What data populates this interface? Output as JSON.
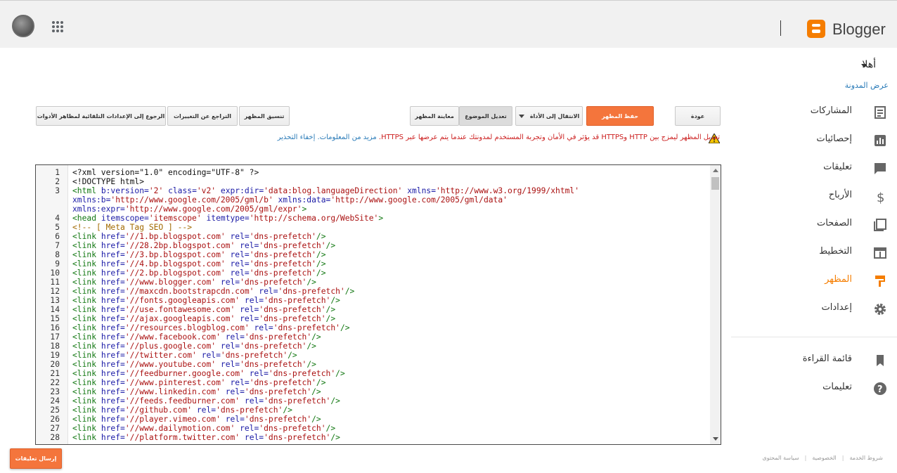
{
  "header": {
    "brand": "Blogger",
    "apps_icon": "apps-grid-icon",
    "avatar_icon": "user-avatar"
  },
  "user": {
    "greeting": "أهلا",
    "view_blog": "عرض المدونة"
  },
  "nav": {
    "items": [
      {
        "label": "المشاركات",
        "icon": "posts-icon",
        "active": false
      },
      {
        "label": "إحصائيات",
        "icon": "stats-icon",
        "active": false
      },
      {
        "label": "تعليقات",
        "icon": "comments-icon",
        "active": false
      },
      {
        "label": "الأرباح",
        "icon": "dollar-icon",
        "active": false
      },
      {
        "label": "الصفحات",
        "icon": "pages-icon",
        "active": false
      },
      {
        "label": "التخطيط",
        "icon": "layout-icon",
        "active": false
      },
      {
        "label": "المظهر",
        "icon": "theme-brush-icon",
        "active": true
      },
      {
        "label": "إعدادات",
        "icon": "gear-icon",
        "active": false
      }
    ],
    "secondary": [
      {
        "label": "قائمة القراءة",
        "icon": "bookmark-icon"
      },
      {
        "label": "تعليمات",
        "icon": "help-icon"
      }
    ]
  },
  "toolbar": {
    "back": "عودة",
    "save": "حفظ المظهر",
    "jump_to_widget": "الانتقال إلى الأداة",
    "edit_theme": "تعديل الموضوع",
    "preview": "معاينة المظهر",
    "format": "تنسيق المظهر",
    "revert": "التراجع عن التغييرات",
    "reset_widgets": "الرجوع إلى الإعدادات التلقائية لمظاهر الأدوات"
  },
  "warning": {
    "text": "تعديل المظهر ليمزج بين HTTP وHTTPS قد يؤثر في الأمان وتجربة المستخدم لمدونتك عندما يتم عرضها عبر HTTPS.",
    "learn_more": "مزيد من المعلومات.",
    "dismiss": "إخفاء التحذير"
  },
  "editor": {
    "lines": [
      {
        "n": "1",
        "html": "&lt;?xml version=\"1.0\" encoding=\"UTF-8\" ?&gt;"
      },
      {
        "n": "2",
        "html": "&lt;!DOCTYPE html&gt;"
      },
      {
        "n": "3",
        "html": "<span class='t'>&lt;html</span> <span class='a'>b:version=</span><span class='v'>'2'</span> <span class='a'>class=</span><span class='v'>'v2'</span> <span class='a'>expr:dir=</span><span class='v'>'data:blog.languageDirection'</span> <span class='a'>xmlns=</span><span class='v'>'http://www.w3.org/1999/xhtml'</span>"
      },
      {
        "n": "",
        "html": "<span class='a'>xmlns:b=</span><span class='v'>'http://www.google.com/2005/gml/b'</span> <span class='a'>xmlns:data=</span><span class='v'>'http://www.google.com/2005/gml/data'</span>"
      },
      {
        "n": "",
        "html": "<span class='a'>xmlns:expr=</span><span class='v'>'http://www.google.com/2005/gml/expr'</span><span class='t'>&gt;</span>"
      },
      {
        "n": "4",
        "html": "<span class='t'>&lt;head</span> <span class='a'>itemscope=</span><span class='v'>'itemscope'</span> <span class='a'>itemtype=</span><span class='v'>'http://schema.org/WebSite'</span><span class='t'>&gt;</span>"
      },
      {
        "n": "5",
        "html": "<span class='c'>&lt;!-- [ Meta Tag SEO ] --&gt;</span>"
      },
      {
        "n": "6",
        "html": "<span class='t'>&lt;link</span> <span class='a'>href=</span><span class='v'>'//1.bp.blogspot.com'</span> <span class='a'>rel=</span><span class='v'>'dns-prefetch'</span><span class='t'>/&gt;</span>"
      },
      {
        "n": "7",
        "html": "<span class='t'>&lt;link</span> <span class='a'>href=</span><span class='v'>'//28.2bp.blogspot.com'</span> <span class='a'>rel=</span><span class='v'>'dns-prefetch'</span><span class='t'>/&gt;</span>"
      },
      {
        "n": "8",
        "html": "<span class='t'>&lt;link</span> <span class='a'>href=</span><span class='v'>'//3.bp.blogspot.com'</span> <span class='a'>rel=</span><span class='v'>'dns-prefetch'</span><span class='t'>/&gt;</span>"
      },
      {
        "n": "9",
        "html": "<span class='t'>&lt;link</span> <span class='a'>href=</span><span class='v'>'//4.bp.blogspot.com'</span> <span class='a'>rel=</span><span class='v'>'dns-prefetch'</span><span class='t'>/&gt;</span>"
      },
      {
        "n": "10",
        "html": "<span class='t'>&lt;link</span> <span class='a'>href=</span><span class='v'>'//2.bp.blogspot.com'</span> <span class='a'>rel=</span><span class='v'>'dns-prefetch'</span><span class='t'>/&gt;</span>"
      },
      {
        "n": "11",
        "html": "<span class='t'>&lt;link</span> <span class='a'>href=</span><span class='v'>'//www.blogger.com'</span> <span class='a'>rel=</span><span class='v'>'dns-prefetch'</span><span class='t'>/&gt;</span>"
      },
      {
        "n": "12",
        "html": "<span class='t'>&lt;link</span> <span class='a'>href=</span><span class='v'>'//maxcdn.bootstrapcdn.com'</span> <span class='a'>rel=</span><span class='v'>'dns-prefetch'</span><span class='t'>/&gt;</span>"
      },
      {
        "n": "13",
        "html": "<span class='t'>&lt;link</span> <span class='a'>href=</span><span class='v'>'//fonts.googleapis.com'</span> <span class='a'>rel=</span><span class='v'>'dns-prefetch'</span><span class='t'>/&gt;</span>"
      },
      {
        "n": "14",
        "html": "<span class='t'>&lt;link</span> <span class='a'>href=</span><span class='v'>'//use.fontawesome.com'</span> <span class='a'>rel=</span><span class='v'>'dns-prefetch'</span><span class='t'>/&gt;</span>"
      },
      {
        "n": "15",
        "html": "<span class='t'>&lt;link</span> <span class='a'>href=</span><span class='v'>'//ajax.googleapis.com'</span> <span class='a'>rel=</span><span class='v'>'dns-prefetch'</span><span class='t'>/&gt;</span>"
      },
      {
        "n": "16",
        "html": "<span class='t'>&lt;link</span> <span class='a'>href=</span><span class='v'>'//resources.blogblog.com'</span> <span class='a'>rel=</span><span class='v'>'dns-prefetch'</span><span class='t'>/&gt;</span>"
      },
      {
        "n": "17",
        "html": "<span class='t'>&lt;link</span> <span class='a'>href=</span><span class='v'>'//www.facebook.com'</span> <span class='a'>rel=</span><span class='v'>'dns-prefetch'</span><span class='t'>/&gt;</span>"
      },
      {
        "n": "18",
        "html": "<span class='t'>&lt;link</span> <span class='a'>href=</span><span class='v'>'//plus.google.com'</span> <span class='a'>rel=</span><span class='v'>'dns-prefetch'</span><span class='t'>/&gt;</span>"
      },
      {
        "n": "19",
        "html": "<span class='t'>&lt;link</span> <span class='a'>href=</span><span class='v'>'//twitter.com'</span> <span class='a'>rel=</span><span class='v'>'dns-prefetch'</span><span class='t'>/&gt;</span>"
      },
      {
        "n": "20",
        "html": "<span class='t'>&lt;link</span> <span class='a'>href=</span><span class='v'>'//www.youtube.com'</span> <span class='a'>rel=</span><span class='v'>'dns-prefetch'</span><span class='t'>/&gt;</span>"
      },
      {
        "n": "21",
        "html": "<span class='t'>&lt;link</span> <span class='a'>href=</span><span class='v'>'//feedburner.google.com'</span> <span class='a'>rel=</span><span class='v'>'dns-prefetch'</span><span class='t'>/&gt;</span>"
      },
      {
        "n": "22",
        "html": "<span class='t'>&lt;link</span> <span class='a'>href=</span><span class='v'>'//www.pinterest.com'</span> <span class='a'>rel=</span><span class='v'>'dns-prefetch'</span><span class='t'>/&gt;</span>"
      },
      {
        "n": "23",
        "html": "<span class='t'>&lt;link</span> <span class='a'>href=</span><span class='v'>'//www.linkedin.com'</span> <span class='a'>rel=</span><span class='v'>'dns-prefetch'</span><span class='t'>/&gt;</span>"
      },
      {
        "n": "24",
        "html": "<span class='t'>&lt;link</span> <span class='a'>href=</span><span class='v'>'//feeds.feedburner.com'</span> <span class='a'>rel=</span><span class='v'>'dns-prefetch'</span><span class='t'>/&gt;</span>"
      },
      {
        "n": "25",
        "html": "<span class='t'>&lt;link</span> <span class='a'>href=</span><span class='v'>'//github.com'</span> <span class='a'>rel=</span><span class='v'>'dns-prefetch'</span><span class='t'>/&gt;</span>"
      },
      {
        "n": "26",
        "html": "<span class='t'>&lt;link</span> <span class='a'>href=</span><span class='v'>'//player.vimeo.com'</span> <span class='a'>rel=</span><span class='v'>'dns-prefetch'</span><span class='t'>/&gt;</span>"
      },
      {
        "n": "27",
        "html": "<span class='t'>&lt;link</span> <span class='a'>href=</span><span class='v'>'//www.dailymotion.com'</span> <span class='a'>rel=</span><span class='v'>'dns-prefetch'</span><span class='t'>/&gt;</span>"
      },
      {
        "n": "28",
        "html": "<span class='t'>&lt;link</span> <span class='a'>href=</span><span class='v'>'//platform.twitter.com'</span> <span class='a'>rel=</span><span class='v'>'dns-prefetch'</span><span class='t'>/&gt;</span>"
      }
    ]
  },
  "feedback": {
    "label": "إرسال تعليقات"
  },
  "footer": {
    "terms": "شروط الخدمة",
    "privacy": "الخصوصية",
    "content_policy": "سياسة المحتوى"
  },
  "colors": {
    "accent": "#f57d00",
    "save_button": "#f4753c",
    "link": "#2a7bb8",
    "warning_text": "#cc2020"
  }
}
